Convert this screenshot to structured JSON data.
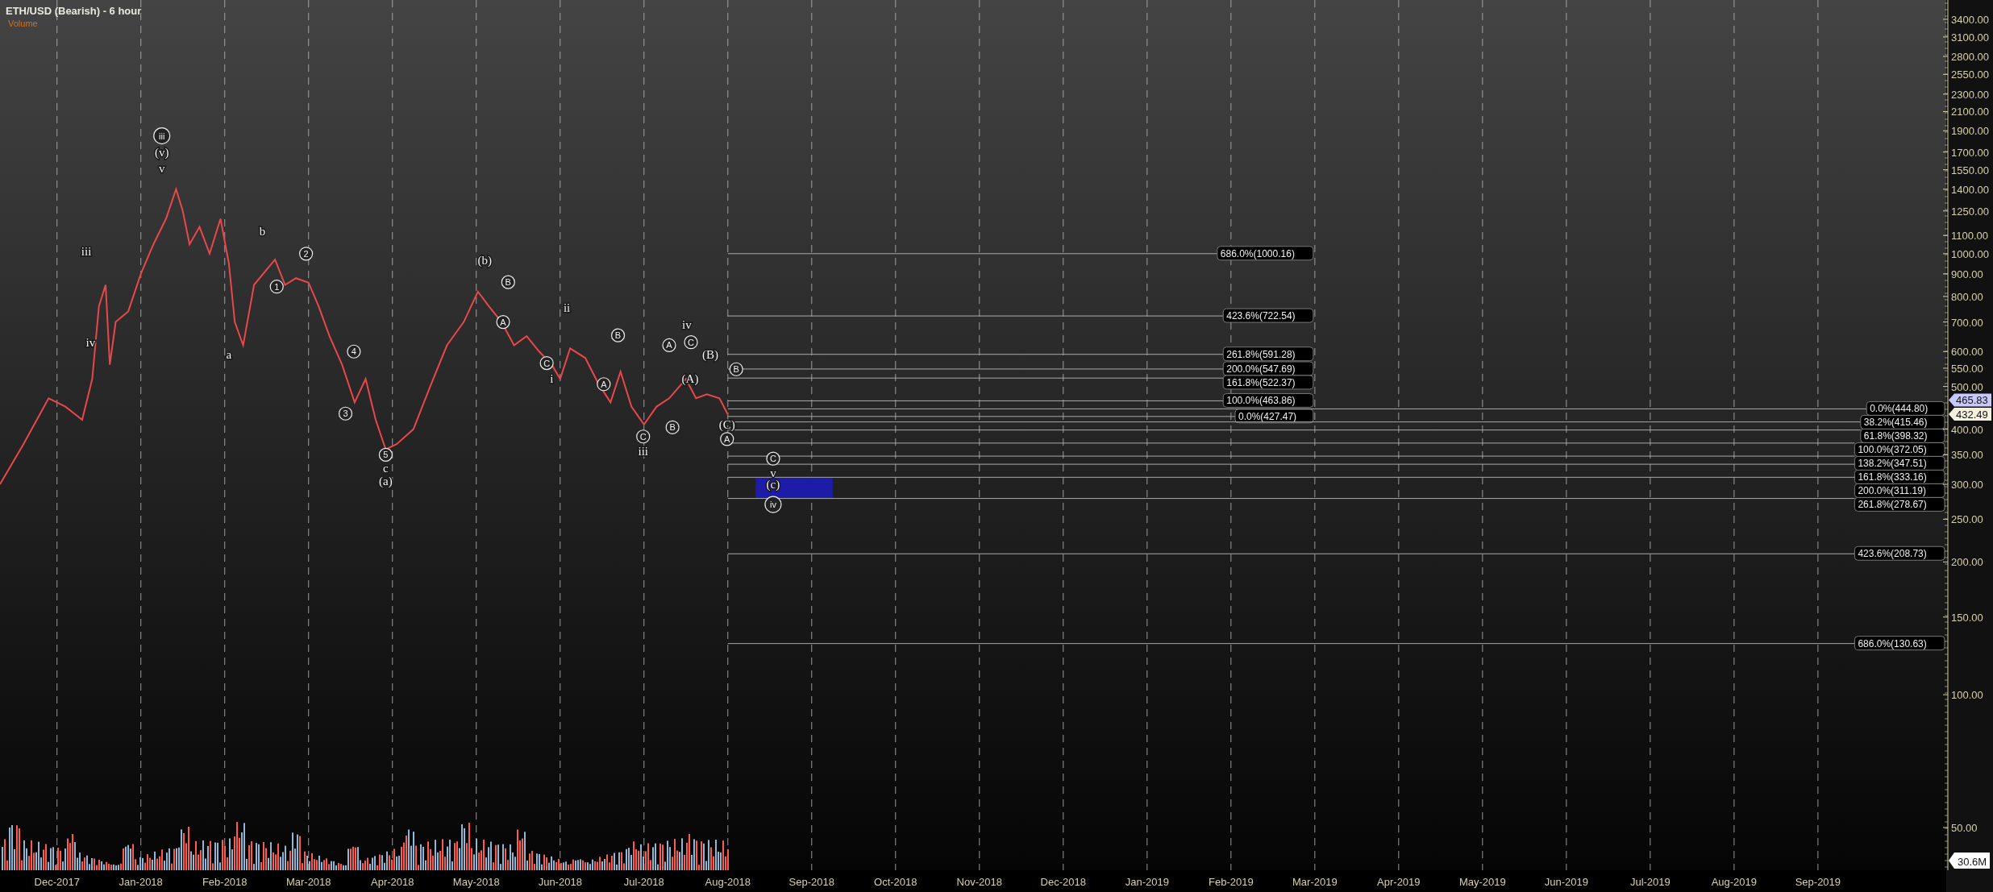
{
  "chart": {
    "title": "ETH/USD (Bearish) - 6 hour",
    "indicator_label": "Volume",
    "volume_reading": "30.6M",
    "price_tags": [
      {
        "value": "465.83",
        "color": "#c8c8ff"
      },
      {
        "value": "432.49",
        "color": "#f5f0dc"
      }
    ],
    "price_axis_labels": [
      "3400.00",
      "3100.00",
      "2800.00",
      "2550.00",
      "2300.00",
      "2100.00",
      "1900.00",
      "1700.00",
      "1550.00",
      "1400.00",
      "1250.00",
      "1100.00",
      "1000.00",
      "900.00",
      "800.00",
      "700.00",
      "600.00",
      "550.00",
      "500.00",
      "400.00",
      "350.00",
      "300.00",
      "250.00",
      "200.00",
      "150.00",
      "100.00",
      "50.00"
    ],
    "date_axis_labels": [
      "Dec-2017",
      "Jan-2018",
      "Feb-2018",
      "Mar-2018",
      "Apr-2018",
      "May-2018",
      "Jun-2018",
      "Jul-2018",
      "Aug-2018",
      "Sep-2018",
      "Oct-2018",
      "Nov-2018",
      "Dec-2018",
      "Jan-2019",
      "Feb-2019",
      "Mar-2019",
      "Apr-2019",
      "May-2019",
      "Jun-2019",
      "Jul-2019",
      "Aug-2019",
      "Sep-2019"
    ],
    "wave_labels": [
      {
        "text": "iii",
        "circled": true
      },
      {
        "text": "(v)",
        "circled": false
      },
      {
        "text": "v",
        "circled": false
      },
      {
        "text": "iii",
        "circled": false
      },
      {
        "text": "iv",
        "circled": false
      },
      {
        "text": "b",
        "circled": false
      },
      {
        "text": "a",
        "circled": false
      },
      {
        "text": "1",
        "circled": true
      },
      {
        "text": "2",
        "circled": true
      },
      {
        "text": "3",
        "circled": true
      },
      {
        "text": "4",
        "circled": true
      },
      {
        "text": "5",
        "circled": true
      },
      {
        "text": "c",
        "circled": false
      },
      {
        "text": "(a)",
        "circled": false
      },
      {
        "text": "(b)",
        "circled": false
      },
      {
        "text": "B",
        "circled": true
      },
      {
        "text": "A",
        "circled": true
      },
      {
        "text": "ii",
        "circled": false
      },
      {
        "text": "C",
        "circled": true
      },
      {
        "text": "i",
        "circled": false
      },
      {
        "text": "B",
        "circled": true
      },
      {
        "text": "A",
        "circled": true
      },
      {
        "text": "C",
        "circled": true
      },
      {
        "text": "iii",
        "circled": false
      },
      {
        "text": "A",
        "circled": true
      },
      {
        "text": "B",
        "circled": true
      },
      {
        "text": "iv",
        "circled": false
      },
      {
        "text": "C",
        "circled": true
      },
      {
        "text": "(B)",
        "circled": false
      },
      {
        "text": "(A)",
        "circled": false
      },
      {
        "text": "B",
        "circled": true
      },
      {
        "text": "(C)",
        "circled": false
      },
      {
        "text": "A",
        "circled": true
      },
      {
        "text": "C",
        "circled": true
      },
      {
        "text": "v",
        "circled": false
      },
      {
        "text": "(c)",
        "circled": false
      },
      {
        "text": "iv",
        "circled": true
      }
    ],
    "target_zone": {
      "color": "#1c1ca8"
    },
    "fib_levels": [
      {
        "text": "686.0%(1000.16)"
      },
      {
        "text": "423.6%(722.54)"
      },
      {
        "text": "261.8%(591.28)"
      },
      {
        "text": "200.0%(547.69)"
      },
      {
        "text": "161.8%(522.37)"
      },
      {
        "text": "100.0%(463.86)"
      },
      {
        "text": "0.0%(427.47)"
      },
      {
        "text": "0.0%(444.80)"
      },
      {
        "text": "38.2%(415.46)"
      },
      {
        "text": "61.8%(398.32)"
      },
      {
        "text": "100.0%(372.05)"
      },
      {
        "text": "138.2%(347.51)"
      },
      {
        "text": "161.8%(333.16)"
      },
      {
        "text": "200.0%(311.19)"
      },
      {
        "text": "261.8%(278.67)"
      },
      {
        "text": "423.6%(208.73)"
      },
      {
        "text": "686.0%(130.63)"
      }
    ]
  }
}
